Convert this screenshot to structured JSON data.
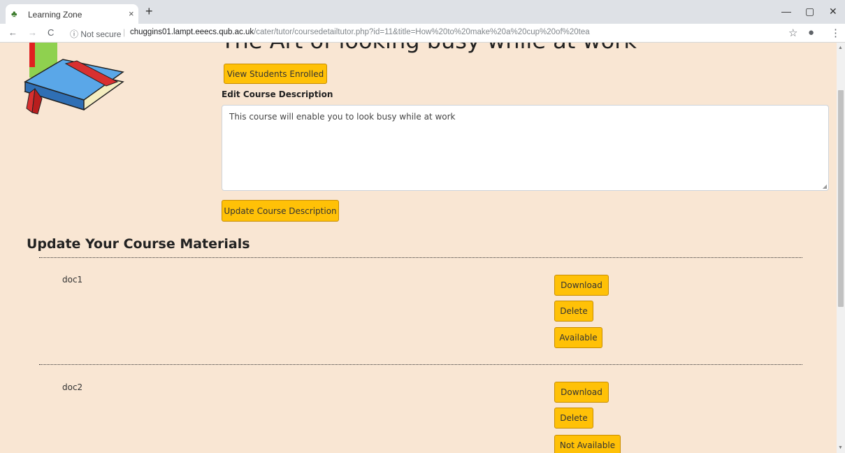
{
  "browser": {
    "tab_title": "Learning Zone",
    "new_tab": "+",
    "tab_close": "×",
    "security_label": "Not secure",
    "url_host": "chuggins01.lampt.eeecs.qub.ac.uk",
    "url_path": "/cater/tutor/coursedetailtutor.php?id=11&title=How%20to%20make%20a%20cup%20of%20tea",
    "back_icon": "←",
    "forward_icon": "→",
    "reload_icon": "C",
    "info_icon": "ⓘ",
    "star_icon": "☆",
    "account_icon": "●",
    "menu_icon": "⋮",
    "minimize_icon": "—",
    "maximize_icon": "▢",
    "close_icon": "✕"
  },
  "course": {
    "title": "The Art of looking busy while at work",
    "view_students_label": "View Students Enrolled",
    "edit_description_label": "Edit Course Description",
    "description": "This course will enable you to look busy while at work",
    "update_description_label": "Update Course Description"
  },
  "materials": {
    "heading": "Update Your Course Materials",
    "items": [
      {
        "name": "doc1",
        "download_label": "Download",
        "delete_label": "Delete",
        "availability_label": "Available"
      },
      {
        "name": "doc2",
        "download_label": "Download",
        "delete_label": "Delete",
        "availability_label": "Not Available"
      }
    ]
  },
  "colors": {
    "page_background": "#f9e6d3",
    "button": "#ffc107"
  }
}
